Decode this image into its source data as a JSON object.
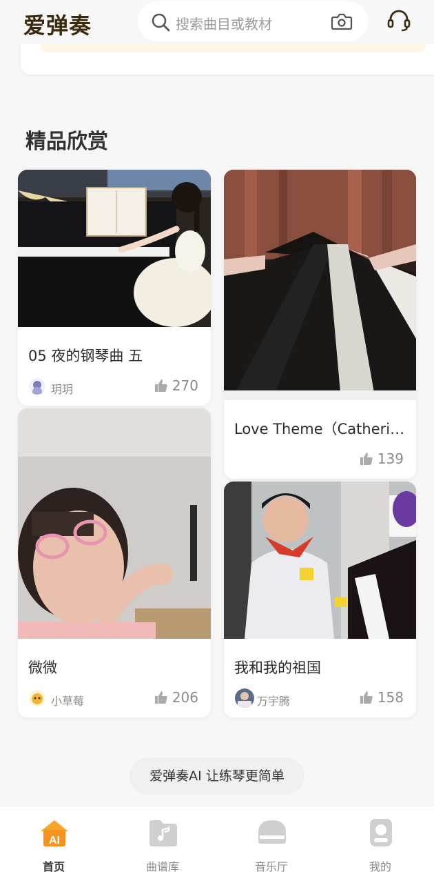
{
  "header": {
    "logo": "爱弹奏",
    "search_placeholder": "搜索曲目或教材"
  },
  "section": {
    "title": "精品欣赏"
  },
  "cards": [
    {
      "title": "05 夜的钢琴曲 五",
      "author": "玥玥",
      "likes": "270"
    },
    {
      "title": "Love Theme（Catherin...",
      "author": "",
      "likes": "139"
    },
    {
      "title": "微微",
      "author": "小草莓",
      "likes": "206"
    },
    {
      "title": "我和我的祖国",
      "author": "万宇腾",
      "likes": "158"
    }
  ],
  "promo": {
    "text": "爱弹奏AI 让练琴更简单"
  },
  "tabbar": {
    "tabs": [
      {
        "label": "首页",
        "active": true
      },
      {
        "label": "曲谱库",
        "active": false
      },
      {
        "label": "音乐厅",
        "active": false
      },
      {
        "label": "我的",
        "active": false
      }
    ]
  },
  "colors": {
    "accent": "#f5a623",
    "brand_dark": "#3a2a0e",
    "inactive": "#8a8a8a"
  }
}
